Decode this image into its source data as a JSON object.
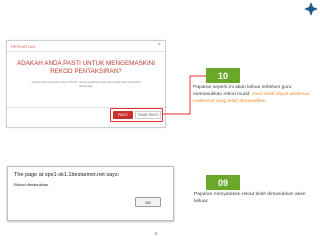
{
  "modal": {
    "title": "PERHATIAN",
    "close_symbol": "×",
    "heading": "ADAKAH ANDA PASTI UNTUK MENGEMASKINI REKOD PENTAKSIRAN?",
    "subtext": "Setelah anda menekan butang 'PASTI', rekod pentaksiran akan dikemaskini dan tidak boleh diubah lagi.",
    "confirm_label": "PASTI",
    "cancel_label": "TIDAK PASTI"
  },
  "steps": [
    {
      "number": "10",
      "text": "Paparan seperti ini akan keluar sebelum guru memasukkan rekod murid. ",
      "highlight": "Guru tidak dapat ubahsuai maklumat yang telah dimasukkan."
    },
    {
      "number": "09",
      "text": "Paparan menyatakan rekod telah dimasukkan akan keluar."
    }
  ],
  "alert": {
    "title": "The page at sps1-sk1.1bestarinet.net says:",
    "message": "Rekod dimasukkan.",
    "ok_label": "OK"
  },
  "page_number": "8",
  "colors": {
    "badge": "#6aa82a",
    "highlight_border": "#e3342f",
    "confirm_button": "#c9302c",
    "heading": "#c0392b",
    "emphasis_text": "#f08a24"
  },
  "icons": {
    "corner": "corner-mark-icon"
  }
}
